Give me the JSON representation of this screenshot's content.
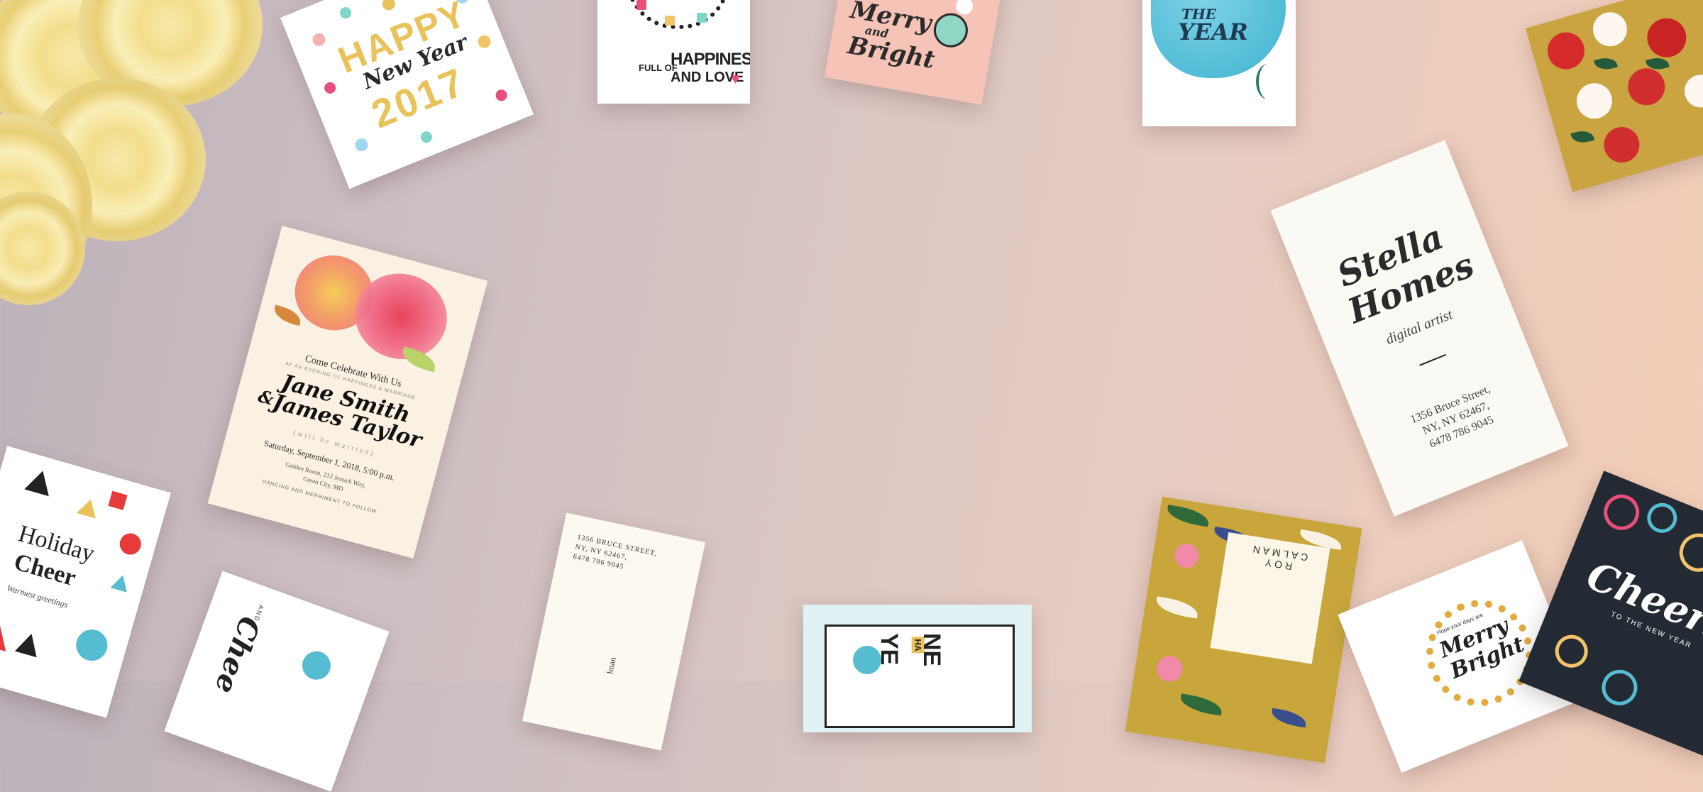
{
  "cards": {
    "happy_new_year": {
      "line1": "HAPPY",
      "line2": "New Year",
      "line3": "2017"
    },
    "happiness": {
      "line1": "FULL OF",
      "line2": "HAPPINESS",
      "line3": "AND LOVE"
    },
    "merry_bright": {
      "line1": "Merry",
      "line2": "and",
      "line3": "Bright"
    },
    "year_card": {
      "line1": "THE",
      "line2": "YEAR"
    },
    "wedding": {
      "heading": "Come Celebrate With Us",
      "subheading": "AT AN EVENING OF HAPPINESS & MARRIAGE",
      "name1": "Jane Smith",
      "amp": "&",
      "name2": "James Taylor",
      "will": "(will be married)",
      "date": "Saturday, September 1, 2018, 5:00 p.m.",
      "venue1": "Golden Room, 212 Jessick Way,",
      "venue2": "Green City, MD",
      "footer": "DANCING AND MERRIMENT TO FOLLOW"
    },
    "stella": {
      "name1": "Stella",
      "name2": "Homes",
      "title": "digital artist",
      "addr1": "1356 Bruce Street,",
      "addr2": "NY, NY 62467,",
      "addr3": "6478 786 9045"
    },
    "holiday": {
      "line1": "Holiday",
      "line2": "Cheer",
      "line3": "Warmest greetings"
    },
    "small_address": {
      "addr1": "1356 BRUCE STREET,",
      "addr2": "NY, NY 62467,",
      "addr3": "6478 786 9045",
      "bottom": "lman"
    },
    "roy": {
      "name": "ROY CALMAN"
    },
    "cheers": {
      "line1": "Cheers",
      "line2": "TO THE NEW YEAR"
    },
    "new_year_frame": {
      "line1": "NE",
      "line2": "YE",
      "tag": "HA"
    },
    "merry_bottom": {
      "line1": "Merry",
      "line2": "Bright",
      "small": "Hope your days are"
    },
    "cheer_bottom": {
      "line1": "Chee",
      "small": "AND A"
    }
  },
  "colors": {
    "bg_left": "#bdb2bb",
    "bg_right": "#f3cdb6",
    "gold": "#e9c35a",
    "pink": "#f2b2ae",
    "teal": "#56bcd2",
    "dark": "#232a33"
  }
}
